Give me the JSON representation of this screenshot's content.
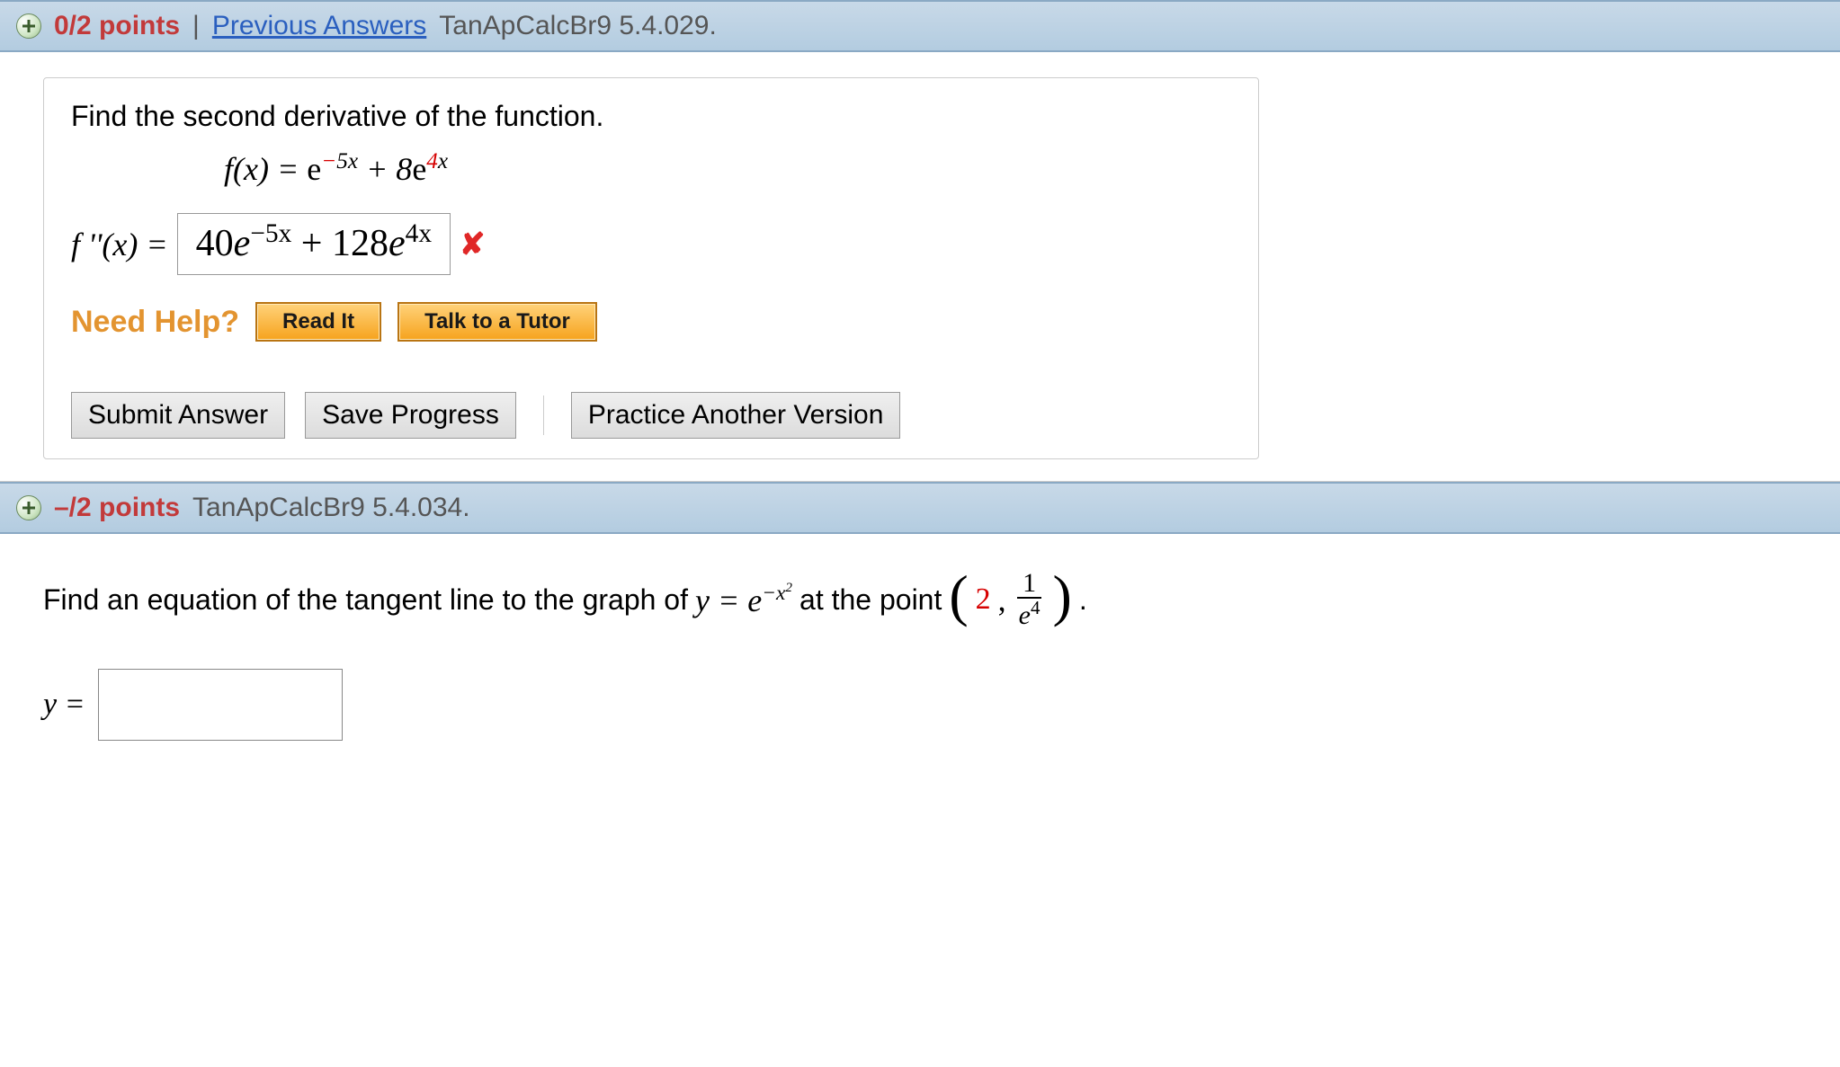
{
  "q1": {
    "points": "0/2 points",
    "previous_link": "Previous Answers",
    "reference": "TanApCalcBr9 5.4.029.",
    "prompt": "Find the second derivative of the function.",
    "function_label": "f(x) = ",
    "function_e": "e",
    "function_exp1_a": "−",
    "function_exp1_b": "5",
    "function_exp1_c": "x",
    "function_plus": " + 8",
    "function_e2": "e",
    "function_exp2_a": "4",
    "function_exp2_b": "x",
    "fpp_label": "f ''(x) = ",
    "answer_text_1": "40",
    "answer_text_e1": "e",
    "answer_exp1": "−5x",
    "answer_text_plus": " + 128",
    "answer_text_e2": "e",
    "answer_exp2": "4x",
    "need_help": "Need Help?",
    "read_it": "Read It",
    "talk_tutor": "Talk to a Tutor",
    "submit": "Submit Answer",
    "save": "Save Progress",
    "practice": "Practice Another Version"
  },
  "q2": {
    "points": "–/2 points",
    "reference": "TanApCalcBr9 5.4.034.",
    "prompt_a": "Find an equation of the tangent line to the graph of ",
    "y_eq": "y = e",
    "exp": "−x",
    "exp_sq": "2",
    "prompt_b": " at the point ",
    "pt_two": "2",
    "comma": ", ",
    "frac_num": "1",
    "frac_den_e": "e",
    "frac_den_exp": "4",
    "period": ".",
    "y_label": "y ="
  }
}
